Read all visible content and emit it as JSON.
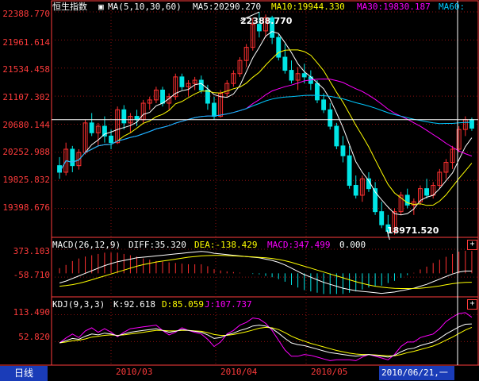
{
  "main_header": {
    "index_name": "恒生指数",
    "ma_label": "MA(5,10,30,60)",
    "ma5": "MA5:20290.270",
    "ma10": "MA10:19944.330",
    "ma30": "MA30:19830.187",
    "ma60": "MA60:"
  },
  "macd_header": {
    "name": "MACD(26,12,9)",
    "diff": "DIFF:35.320",
    "dea": "DEA:-138.429",
    "macd": "MACD:347.499",
    "extra": "0.000"
  },
  "kdj_header": {
    "name": "KDJ(9,3,3)",
    "k": "K:92.618",
    "d": "D:85.059",
    "j": "J:107.737"
  },
  "price_axis": [
    "22388.770",
    "21961.614",
    "21534.458",
    "21107.302",
    "20680.144",
    "20252.988",
    "19825.832",
    "19398.676"
  ],
  "macd_axis": [
    "373.103",
    "-58.710"
  ],
  "kdj_axis": [
    "113.490",
    "52.820"
  ],
  "annotations": {
    "high": "22388.770",
    "low": "18971.520"
  },
  "dates": [
    "2010/03",
    "2010/04",
    "2010/05"
  ],
  "period_tab": "日线",
  "cursor_date": "2010/06/21,一",
  "plus_icon": "+",
  "colors": {
    "up": "#ff3030",
    "down": "#00e5e5",
    "ma5": "#ffffff",
    "ma10": "#ffff00",
    "ma30": "#ff00ff",
    "ma60": "#00c8ff",
    "axis": "#ff3b3b",
    "grid": "#8b1010"
  },
  "chart_data": [
    {
      "type": "candlestick",
      "title": "恒生指数",
      "x_start": "2010-02-03",
      "candles": [
        [
          20050,
          20180,
          19850,
          19950
        ],
        [
          19950,
          20400,
          19900,
          20300
        ],
        [
          20300,
          20350,
          19950,
          20050
        ],
        [
          20050,
          20300,
          19990,
          20250
        ],
        [
          20250,
          20750,
          20220,
          20700
        ],
        [
          20700,
          20850,
          20500,
          20550
        ],
        [
          20550,
          20700,
          20350,
          20650
        ],
        [
          20650,
          20800,
          20400,
          20500
        ],
        [
          20500,
          20600,
          20300,
          20400
        ],
        [
          20400,
          20950,
          20380,
          20900
        ],
        [
          20900,
          20970,
          20600,
          20700
        ],
        [
          20700,
          20850,
          20550,
          20800
        ],
        [
          20800,
          20900,
          20650,
          20750
        ],
        [
          20750,
          21050,
          20700,
          21000
        ],
        [
          21000,
          21100,
          20900,
          21050
        ],
        [
          21050,
          21250,
          21000,
          21200
        ],
        [
          21200,
          21250,
          20950,
          21000
        ],
        [
          21000,
          21150,
          20900,
          21100
        ],
        [
          21100,
          21450,
          21050,
          21400
        ],
        [
          21400,
          21450,
          21200,
          21250
        ],
        [
          21250,
          21350,
          21100,
          21300
        ],
        [
          21300,
          21400,
          21200,
          21350
        ],
        [
          21350,
          21420,
          21150,
          21200
        ],
        [
          21200,
          21280,
          20900,
          21000
        ],
        [
          21000,
          21100,
          20750,
          20800
        ],
        [
          20800,
          21200,
          20780,
          21150
        ],
        [
          21150,
          21350,
          21100,
          21300
        ],
        [
          21300,
          21500,
          21250,
          21450
        ],
        [
          21450,
          21700,
          21400,
          21650
        ],
        [
          21650,
          21900,
          21550,
          21850
        ],
        [
          21850,
          22300,
          21800,
          22200
        ],
        [
          22200,
          22388,
          22000,
          22100
        ],
        [
          22100,
          22350,
          22000,
          22300
        ],
        [
          22300,
          22330,
          21900,
          22000
        ],
        [
          22000,
          22050,
          21650,
          21700
        ],
        [
          21700,
          21900,
          21450,
          21500
        ],
        [
          21500,
          21650,
          21300,
          21350
        ],
        [
          21350,
          21550,
          21200,
          21450
        ],
        [
          21450,
          21600,
          21300,
          21400
        ],
        [
          21400,
          21500,
          21200,
          21300
        ],
        [
          21300,
          21350,
          21000,
          21050
        ],
        [
          21050,
          21150,
          20850,
          20900
        ],
        [
          20900,
          21000,
          20600,
          20650
        ],
        [
          20650,
          20700,
          20300,
          20350
        ],
        [
          20350,
          20500,
          20100,
          20200
        ],
        [
          20200,
          20350,
          19700,
          19750
        ],
        [
          19750,
          19900,
          19550,
          19600
        ],
        [
          19600,
          19900,
          19500,
          19850
        ],
        [
          19850,
          19950,
          19650,
          19700
        ],
        [
          19700,
          19800,
          19300,
          19350
        ],
        [
          19350,
          19500,
          19100,
          19150
        ],
        [
          19150,
          19300,
          18971,
          19050
        ],
        [
          19050,
          19400,
          19000,
          19350
        ],
        [
          19350,
          19650,
          19300,
          19600
        ],
        [
          19600,
          19700,
          19400,
          19450
        ],
        [
          19450,
          19550,
          19300,
          19500
        ],
        [
          19500,
          19750,
          19450,
          19700
        ],
        [
          19700,
          19850,
          19550,
          19600
        ],
        [
          19600,
          19800,
          19550,
          19750
        ],
        [
          19750,
          20000,
          19700,
          19950
        ],
        [
          19950,
          20150,
          19850,
          20100
        ],
        [
          20100,
          20350,
          20000,
          20300
        ],
        [
          20300,
          20650,
          20250,
          20600
        ],
        [
          20600,
          20800,
          20500,
          20750
        ],
        [
          20750,
          20780,
          20580,
          20620
        ]
      ]
    },
    {
      "type": "line",
      "title": "MACD(26,12,9)",
      "series": [
        {
          "name": "DIFF",
          "values": [
            -150,
            -120,
            -80,
            -40,
            0,
            40,
            80,
            120,
            150,
            180,
            200,
            220,
            240,
            250,
            260,
            270,
            280,
            290,
            300,
            310,
            320,
            330,
            340,
            330,
            310,
            300,
            290,
            280,
            270,
            260,
            250,
            240,
            220,
            200,
            170,
            130,
            80,
            30,
            -20,
            -60,
            -100,
            -140,
            -170,
            -200,
            -230,
            -250,
            -270,
            -280,
            -290,
            -300,
            -310,
            -300,
            -290,
            -270,
            -250,
            -230,
            -200,
            -170,
            -130,
            -90,
            -50,
            -10,
            20,
            35,
            35
          ]
        },
        {
          "name": "DEA",
          "values": [
            -200,
            -190,
            -175,
            -155,
            -130,
            -100,
            -70,
            -40,
            -10,
            20,
            50,
            80,
            110,
            135,
            155,
            175,
            190,
            205,
            220,
            235,
            250,
            260,
            270,
            275,
            278,
            278,
            275,
            270,
            265,
            260,
            255,
            248,
            240,
            230,
            215,
            195,
            170,
            140,
            110,
            80,
            50,
            20,
            -10,
            -40,
            -70,
            -100,
            -130,
            -155,
            -180,
            -200,
            -215,
            -225,
            -232,
            -235,
            -236,
            -234,
            -230,
            -222,
            -210,
            -195,
            -178,
            -160,
            -148,
            -140,
            -138
          ]
        },
        {
          "name": "MACD",
          "values": [
            80,
            130,
            190,
            230,
            260,
            280,
            300,
            320,
            320,
            320,
            300,
            280,
            260,
            230,
            210,
            190,
            180,
            170,
            160,
            150,
            140,
            140,
            140,
            110,
            64,
            44,
            30,
            20,
            10,
            0,
            -10,
            -16,
            -40,
            -60,
            -90,
            -130,
            -180,
            -220,
            -260,
            -280,
            -300,
            -320,
            -320,
            -320,
            -320,
            -300,
            -280,
            -250,
            -220,
            -200,
            -190,
            -150,
            -116,
            -70,
            -28,
            8,
            60,
            104,
            160,
            210,
            256,
            300,
            336,
            350,
            347
          ]
        }
      ]
    },
    {
      "type": "line",
      "title": "KDJ(9,3,3)",
      "series": [
        {
          "name": "K",
          "values": [
            50,
            55,
            60,
            58,
            65,
            70,
            68,
            72,
            70,
            66,
            70,
            74,
            76,
            78,
            80,
            82,
            78,
            74,
            76,
            80,
            78,
            76,
            74,
            68,
            60,
            62,
            68,
            72,
            78,
            82,
            88,
            90,
            88,
            82,
            72,
            60,
            50,
            46,
            44,
            40,
            36,
            32,
            28,
            26,
            24,
            22,
            20,
            22,
            24,
            22,
            20,
            18,
            22,
            30,
            36,
            38,
            44,
            48,
            52,
            60,
            70,
            78,
            86,
            92,
            92.6
          ]
        },
        {
          "name": "D",
          "values": [
            50,
            52,
            55,
            56,
            59,
            63,
            65,
            67,
            68,
            67,
            68,
            70,
            72,
            74,
            76,
            78,
            78,
            77,
            77,
            78,
            78,
            77,
            76,
            73,
            69,
            67,
            67,
            69,
            72,
            75,
            79,
            83,
            85,
            84,
            80,
            73,
            65,
            59,
            54,
            49,
            45,
            41,
            37,
            33,
            30,
            27,
            25,
            24,
            24,
            23,
            22,
            21,
            21,
            24,
            28,
            31,
            35,
            39,
            43,
            49,
            56,
            63,
            71,
            79,
            85
          ]
        },
        {
          "name": "J",
          "values": [
            50,
            61,
            70,
            62,
            77,
            84,
            74,
            82,
            74,
            64,
            74,
            82,
            84,
            86,
            88,
            90,
            78,
            68,
            74,
            84,
            78,
            74,
            70,
            58,
            42,
            52,
            70,
            78,
            90,
            96,
            106,
            104,
            94,
            78,
            56,
            34,
            20,
            20,
            24,
            22,
            18,
            14,
            10,
            12,
            12,
            12,
            10,
            18,
            24,
            20,
            16,
            12,
            24,
            42,
            52,
            52,
            62,
            66,
            70,
            82,
            98,
            108,
            116,
            118,
            107.7
          ]
        }
      ]
    }
  ]
}
